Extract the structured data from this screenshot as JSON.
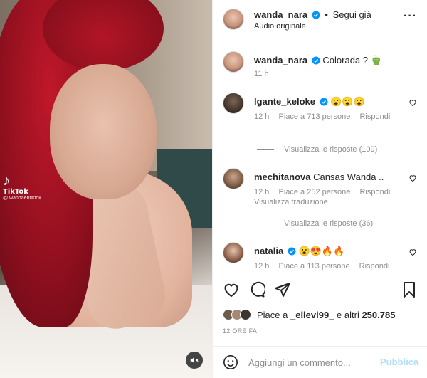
{
  "post": {
    "author": "wanda_nara",
    "follow_status": "Segui già",
    "audio": "Audio originale",
    "caption": "Colorada ? 🫑",
    "caption_time": "11 h",
    "media": {
      "watermark_brand": "TikTok",
      "watermark_handle": "@ wandaentiktok",
      "mute_icon": "muted-speaker-icon"
    }
  },
  "comments": [
    {
      "user": "lgante_keloke",
      "verified": true,
      "text": "😮😮😮",
      "time": "12 h",
      "likes": "Piace a 713 persone",
      "reply": "Rispondi"
    },
    {
      "user": "mechitanova",
      "verified": false,
      "text": "Cansas Wanda ..",
      "time": "12 h",
      "likes": "Piace a 252 persone",
      "reply": "Rispondi",
      "translate": "Visualizza traduzione"
    },
    {
      "user": "natalia",
      "verified": true,
      "text": "😮😍🔥🔥",
      "time": "12 h",
      "likes": "Piace a 113 persone",
      "reply": "Rispondi"
    }
  ],
  "replies": [
    "Visualizza le risposte (109)",
    "Visualizza le risposte (36)"
  ],
  "likes": {
    "prefix": "Piace a ",
    "user": "_ellevi99_",
    "suffix": " e altri ",
    "count": "250.785"
  },
  "timestamp": "12 ORE FA",
  "compose": {
    "placeholder": "Aggiungi un commento...",
    "post_label": "Pubblica"
  },
  "icons": [
    "heart-icon",
    "comment-icon",
    "share-icon",
    "bookmark-icon",
    "emoji-icon",
    "more-icon",
    "verified-icon"
  ],
  "colors": {
    "verified": "#0095f6",
    "muted_text": "#8e8e8e",
    "post_disabled": "#b2dffc",
    "hair_red": "#b21526"
  }
}
